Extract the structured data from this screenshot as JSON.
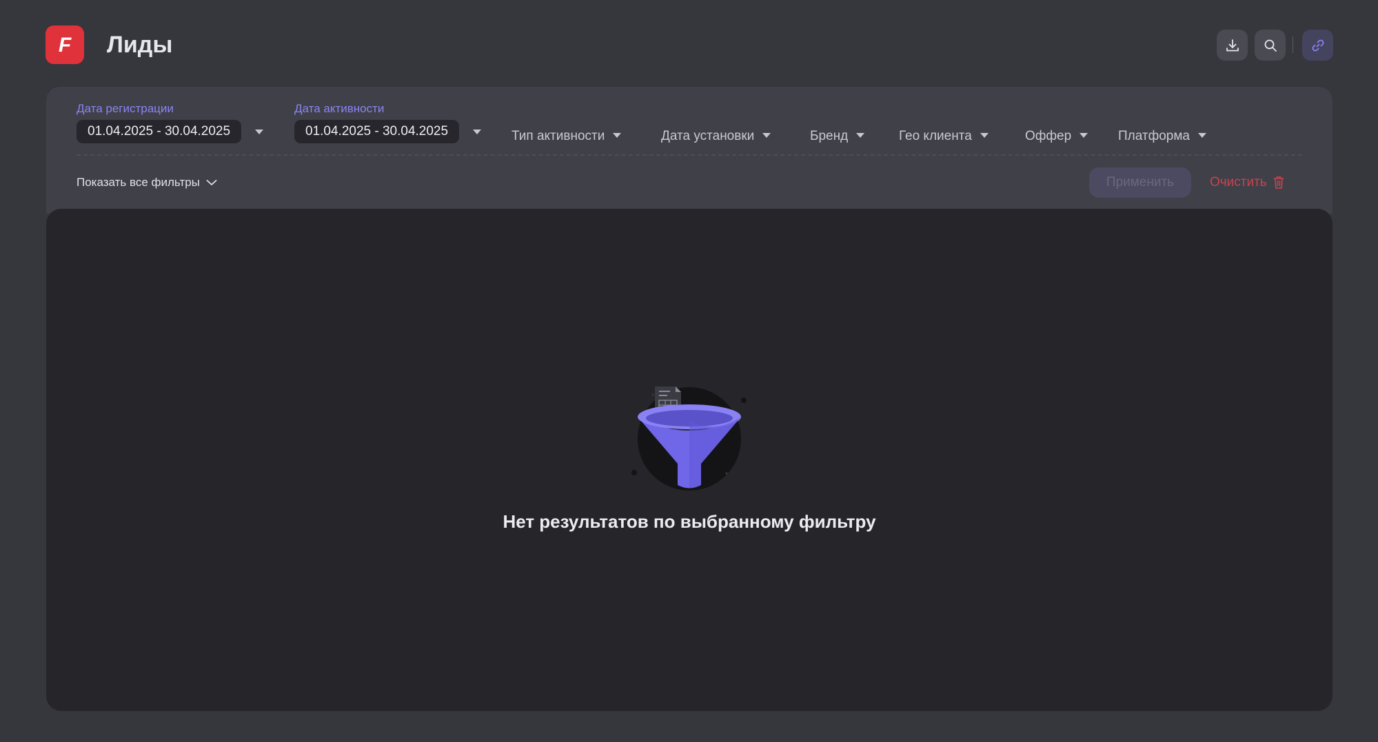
{
  "app": {
    "logo_letter": "F",
    "title": "Лиды",
    "accent_color": "#8a84f2",
    "logo_color": "#e0323b"
  },
  "header": {
    "actions": [
      {
        "name": "download",
        "icon": "download-icon"
      },
      {
        "name": "search",
        "icon": "search-icon"
      },
      {
        "name": "link",
        "icon": "link-icon"
      }
    ]
  },
  "filters": {
    "registration_date": {
      "label": "Дата регистрации",
      "value": "01.04.2025 - 30.04.2025"
    },
    "activity_date": {
      "label": "Дата активности",
      "value": "01.04.2025 - 30.04.2025"
    },
    "dropdowns": {
      "activity_type": "Тип активности",
      "install_date": "Дата установки",
      "brand": "Бренд",
      "client_geo": "Гео клиента",
      "offer": "Оффер",
      "platform": "Платформа"
    },
    "show_all_label": "Показать все фильтры",
    "apply_label": "Применить",
    "clear_label": "Очистить"
  },
  "results": {
    "empty_message": "Нет результатов по выбранному фильтру",
    "illustration": "funnel-with-documents-icon"
  }
}
